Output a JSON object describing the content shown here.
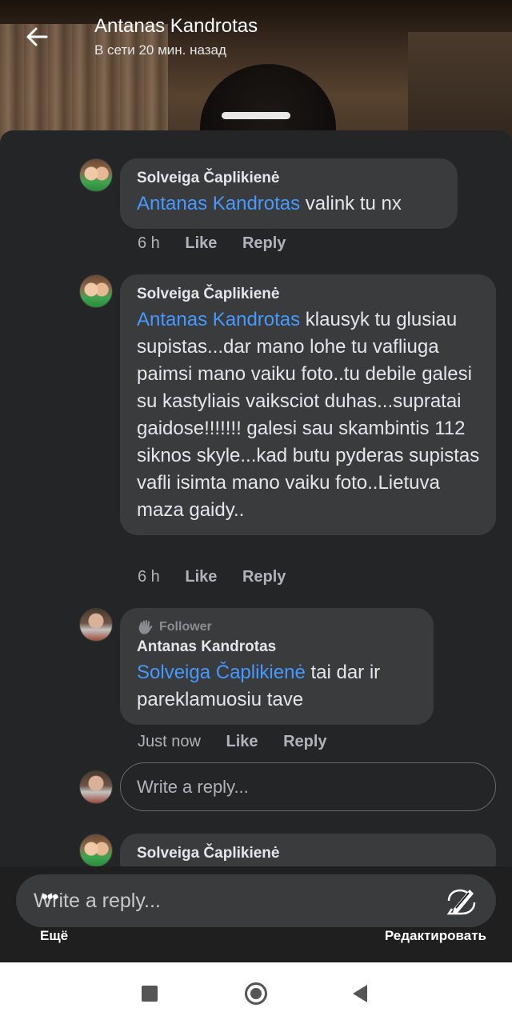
{
  "header": {
    "title": "Antanas Kandrotas",
    "subtitle": "В сети 20 мин. назад"
  },
  "comments": [
    {
      "author": "Solveiga Čaplikienė",
      "mention": "Antanas Kandrotas",
      "text": " valink tu nx",
      "time": "6 h",
      "like": "Like",
      "reply": "Reply"
    },
    {
      "author": "Solveiga Čaplikienė",
      "mention": "Antanas Kandrotas",
      "text": " klausyk tu glusiau supistas...dar mano lohe tu vafliuga paimsi mano vaiku foto..tu debile galesi su kastyliais vaiksciot duhas...supratai gaidose!!!!!!! galesi sau skambintis 112 siknos skyle...kad butu pyderas supistas vafli isimta mano vaiku foto..Lietuva maza gaidy..",
      "time": "6 h",
      "like": "Like",
      "reply": "Reply"
    },
    {
      "badge": "Follower",
      "author": "Antanas Kandrotas",
      "mention": "Solveiga Čaplikienė",
      "text": " tai dar ir pareklamuosiu tave",
      "time": "Just now",
      "like": "Like",
      "reply": "Reply"
    },
    {
      "author": "Solveiga Čaplikienė"
    }
  ],
  "reply_box": {
    "placeholder": "Write a reply..."
  },
  "compose": {
    "placeholder": "Write a reply..."
  },
  "bottom_actions": {
    "more_label": "Ещё",
    "edit_label": "Редактировать"
  },
  "colors": {
    "sheet": "#242526",
    "bubble": "#3a3b3c",
    "mention": "#4599ff"
  }
}
